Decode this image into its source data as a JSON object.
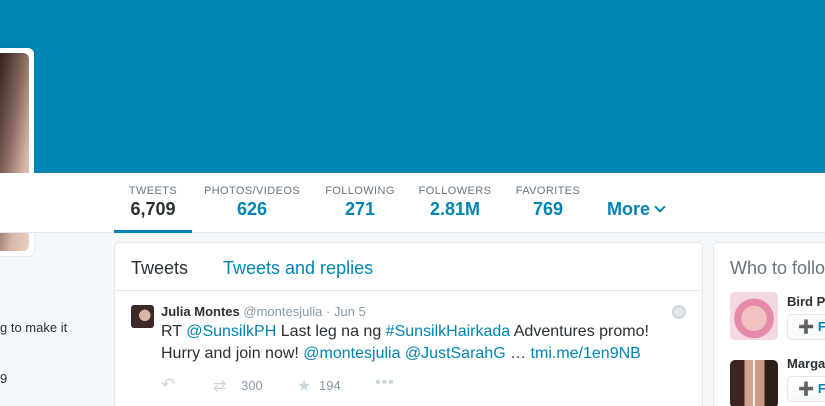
{
  "profile_nav": {
    "stats": [
      {
        "label": "TWEETS",
        "value": "6,709"
      },
      {
        "label": "PHOTOS/VIDEOS",
        "value": "626"
      },
      {
        "label": "FOLLOWING",
        "value": "271"
      },
      {
        "label": "FOLLOWERS",
        "value": "2.81M"
      },
      {
        "label": "FAVORITES",
        "value": "769"
      }
    ],
    "more_label": "More"
  },
  "left_bio": {
    "line1": "g to make it",
    "line2": "9"
  },
  "timeline": {
    "tabs": [
      "Tweets",
      "Tweets and replies"
    ],
    "tweet": {
      "name": "Julia Montes",
      "handle": "@montesjulia",
      "dot": "·",
      "time": "Jun 5",
      "text_parts": {
        "p1": "RT ",
        "m1": "@SunsilkPH",
        "p2": " Last leg na ng ",
        "h1": "#SunsilkHairkada",
        "p3": " Adventures promo! Hurry and join now! ",
        "m2": "@montesjulia",
        "p4": " ",
        "m3": "@JustSarahG",
        "p5": " … ",
        "link": "tmi.me/1en9NB"
      },
      "retweets": "300",
      "favorites": "194",
      "icons": {
        "reply": "reply-icon",
        "retweet": "retweet-icon",
        "favorite": "star-icon",
        "more": "ellipsis-icon",
        "globe": "globe-icon"
      }
    }
  },
  "who_to_follow": {
    "title": "Who to follo",
    "suggestions": [
      {
        "name": "Bird Pi",
        "follow": "F"
      },
      {
        "name": "Marga",
        "follow": "F"
      }
    ]
  },
  "colors": {
    "banner": "#0084b4",
    "accent": "#0084b4"
  }
}
